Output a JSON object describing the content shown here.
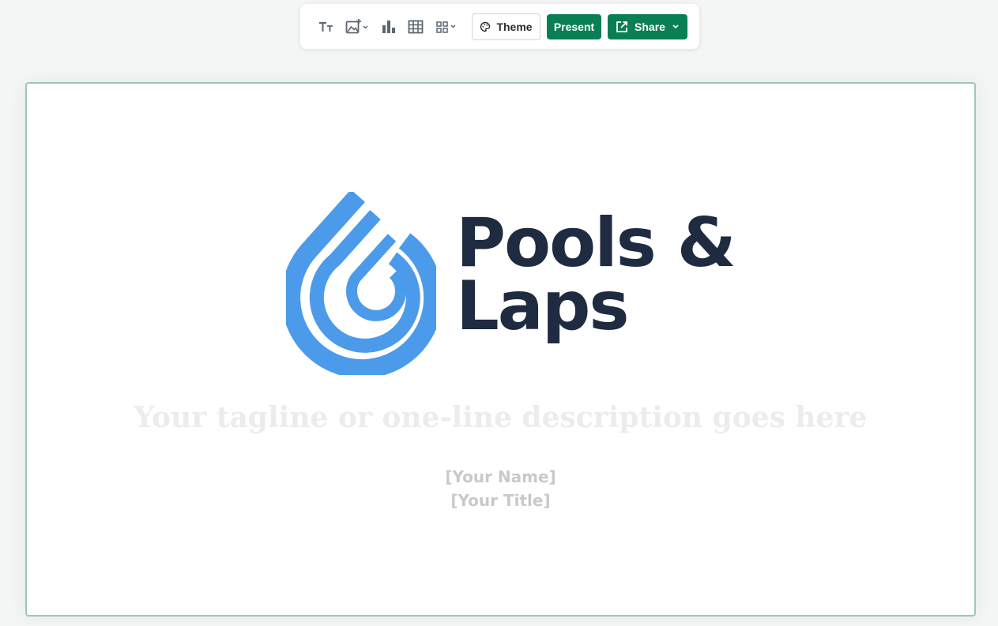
{
  "toolbar": {
    "icons": [
      "text-style-icon",
      "insert-image-icon",
      "bar-chart-icon",
      "table-icon",
      "insert-element-icon"
    ],
    "theme_label": "Theme",
    "present_label": "Present",
    "share_label": "Share"
  },
  "slide": {
    "logo": {
      "line1": "Pools &",
      "line2": "Laps",
      "mark_color": "#4c9bea",
      "text_color": "#1e2b40"
    },
    "tagline": "Your tagline or one-line description goes here",
    "presenter_name": "[Your Name]",
    "presenter_title": "[Your Title]"
  },
  "colors": {
    "accent": "#0b7f54",
    "slide_border": "#9cc7b3",
    "background": "#f4f5f5"
  }
}
